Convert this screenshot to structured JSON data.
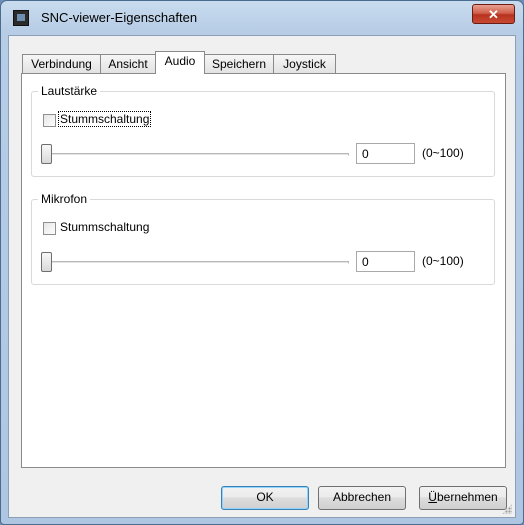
{
  "window": {
    "title": "SNC-viewer-Eigenschaften",
    "close_label": "✕"
  },
  "tabs": [
    {
      "label": "Verbindung"
    },
    {
      "label": "Ansicht"
    },
    {
      "label": "Audio"
    },
    {
      "label": "Speichern"
    },
    {
      "label": "Joystick"
    }
  ],
  "active_tab": "Audio",
  "audio": {
    "volume": {
      "title": "Lautstärke",
      "mute_label": "Stummschaltung",
      "muted": false,
      "value": "0",
      "range_label": "(0~100)"
    },
    "microphone": {
      "title": "Mikrofon",
      "mute_label": "Stummschaltung",
      "muted": false,
      "value": "0",
      "range_label": "(0~100)"
    }
  },
  "buttons": {
    "ok": "OK",
    "cancel": "Abbrechen",
    "apply_mnemonic": "Ü",
    "apply_rest": "bernehmen"
  }
}
